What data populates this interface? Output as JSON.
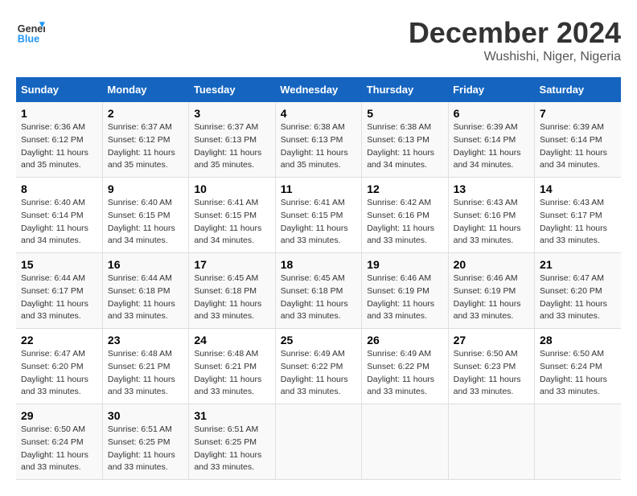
{
  "header": {
    "logo_line1": "General",
    "logo_line2": "Blue",
    "month": "December 2024",
    "location": "Wushishi, Niger, Nigeria"
  },
  "weekdays": [
    "Sunday",
    "Monday",
    "Tuesday",
    "Wednesday",
    "Thursday",
    "Friday",
    "Saturday"
  ],
  "weeks": [
    [
      {
        "day": "1",
        "sunrise": "6:36 AM",
        "sunset": "6:12 PM",
        "daylight": "11 hours and 35 minutes."
      },
      {
        "day": "2",
        "sunrise": "6:37 AM",
        "sunset": "6:12 PM",
        "daylight": "11 hours and 35 minutes."
      },
      {
        "day": "3",
        "sunrise": "6:37 AM",
        "sunset": "6:13 PM",
        "daylight": "11 hours and 35 minutes."
      },
      {
        "day": "4",
        "sunrise": "6:38 AM",
        "sunset": "6:13 PM",
        "daylight": "11 hours and 35 minutes."
      },
      {
        "day": "5",
        "sunrise": "6:38 AM",
        "sunset": "6:13 PM",
        "daylight": "11 hours and 34 minutes."
      },
      {
        "day": "6",
        "sunrise": "6:39 AM",
        "sunset": "6:14 PM",
        "daylight": "11 hours and 34 minutes."
      },
      {
        "day": "7",
        "sunrise": "6:39 AM",
        "sunset": "6:14 PM",
        "daylight": "11 hours and 34 minutes."
      }
    ],
    [
      {
        "day": "8",
        "sunrise": "6:40 AM",
        "sunset": "6:14 PM",
        "daylight": "11 hours and 34 minutes."
      },
      {
        "day": "9",
        "sunrise": "6:40 AM",
        "sunset": "6:15 PM",
        "daylight": "11 hours and 34 minutes."
      },
      {
        "day": "10",
        "sunrise": "6:41 AM",
        "sunset": "6:15 PM",
        "daylight": "11 hours and 34 minutes."
      },
      {
        "day": "11",
        "sunrise": "6:41 AM",
        "sunset": "6:15 PM",
        "daylight": "11 hours and 33 minutes."
      },
      {
        "day": "12",
        "sunrise": "6:42 AM",
        "sunset": "6:16 PM",
        "daylight": "11 hours and 33 minutes."
      },
      {
        "day": "13",
        "sunrise": "6:43 AM",
        "sunset": "6:16 PM",
        "daylight": "11 hours and 33 minutes."
      },
      {
        "day": "14",
        "sunrise": "6:43 AM",
        "sunset": "6:17 PM",
        "daylight": "11 hours and 33 minutes."
      }
    ],
    [
      {
        "day": "15",
        "sunrise": "6:44 AM",
        "sunset": "6:17 PM",
        "daylight": "11 hours and 33 minutes."
      },
      {
        "day": "16",
        "sunrise": "6:44 AM",
        "sunset": "6:18 PM",
        "daylight": "11 hours and 33 minutes."
      },
      {
        "day": "17",
        "sunrise": "6:45 AM",
        "sunset": "6:18 PM",
        "daylight": "11 hours and 33 minutes."
      },
      {
        "day": "18",
        "sunrise": "6:45 AM",
        "sunset": "6:18 PM",
        "daylight": "11 hours and 33 minutes."
      },
      {
        "day": "19",
        "sunrise": "6:46 AM",
        "sunset": "6:19 PM",
        "daylight": "11 hours and 33 minutes."
      },
      {
        "day": "20",
        "sunrise": "6:46 AM",
        "sunset": "6:19 PM",
        "daylight": "11 hours and 33 minutes."
      },
      {
        "day": "21",
        "sunrise": "6:47 AM",
        "sunset": "6:20 PM",
        "daylight": "11 hours and 33 minutes."
      }
    ],
    [
      {
        "day": "22",
        "sunrise": "6:47 AM",
        "sunset": "6:20 PM",
        "daylight": "11 hours and 33 minutes."
      },
      {
        "day": "23",
        "sunrise": "6:48 AM",
        "sunset": "6:21 PM",
        "daylight": "11 hours and 33 minutes."
      },
      {
        "day": "24",
        "sunrise": "6:48 AM",
        "sunset": "6:21 PM",
        "daylight": "11 hours and 33 minutes."
      },
      {
        "day": "25",
        "sunrise": "6:49 AM",
        "sunset": "6:22 PM",
        "daylight": "11 hours and 33 minutes."
      },
      {
        "day": "26",
        "sunrise": "6:49 AM",
        "sunset": "6:22 PM",
        "daylight": "11 hours and 33 minutes."
      },
      {
        "day": "27",
        "sunrise": "6:50 AM",
        "sunset": "6:23 PM",
        "daylight": "11 hours and 33 minutes."
      },
      {
        "day": "28",
        "sunrise": "6:50 AM",
        "sunset": "6:24 PM",
        "daylight": "11 hours and 33 minutes."
      }
    ],
    [
      {
        "day": "29",
        "sunrise": "6:50 AM",
        "sunset": "6:24 PM",
        "daylight": "11 hours and 33 minutes."
      },
      {
        "day": "30",
        "sunrise": "6:51 AM",
        "sunset": "6:25 PM",
        "daylight": "11 hours and 33 minutes."
      },
      {
        "day": "31",
        "sunrise": "6:51 AM",
        "sunset": "6:25 PM",
        "daylight": "11 hours and 33 minutes."
      },
      null,
      null,
      null,
      null
    ]
  ]
}
